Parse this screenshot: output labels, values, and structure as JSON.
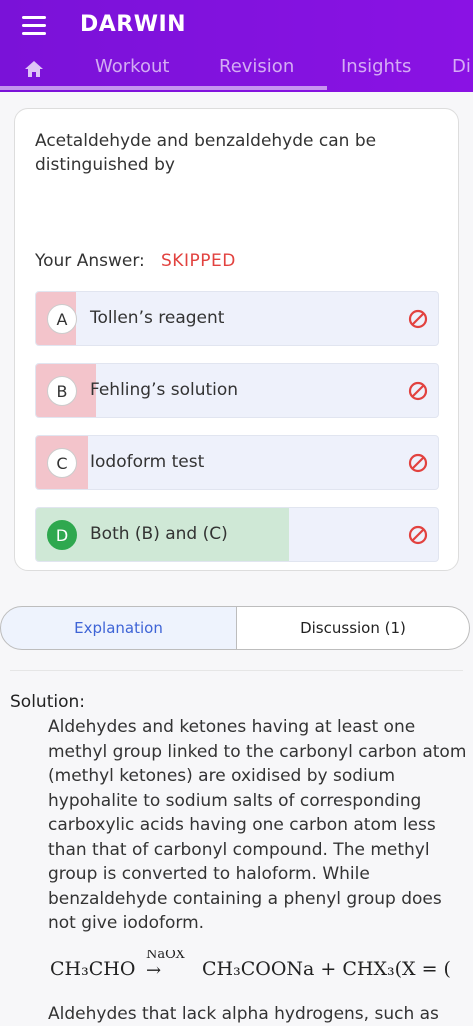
{
  "app": {
    "title": "DARWIN"
  },
  "tabs": [
    "Workout",
    "Revision",
    "Insights",
    "Di"
  ],
  "question": {
    "text": "Acetaldehyde and benzaldehyde can be distinguished by",
    "answer_label": "Your Answer:",
    "answer_status": "SKIPPED",
    "options": [
      {
        "letter": "A",
        "text": "Tollen’s reagent",
        "fill_fraction": 0.1,
        "fill_color": "#f3c4cb",
        "correct": false
      },
      {
        "letter": "B",
        "text": "Fehling’s solution",
        "fill_fraction": 0.15,
        "fill_color": "#f3c4cb",
        "correct": false
      },
      {
        "letter": "C",
        "text": "Iodoform test",
        "fill_fraction": 0.13,
        "fill_color": "#f3c4cb",
        "correct": false
      },
      {
        "letter": "D",
        "text": "Both (B) and (C)",
        "fill_fraction": 0.63,
        "fill_color": "#cfe8d6",
        "correct": true
      }
    ]
  },
  "segment": {
    "explanation": "Explanation",
    "discussion": "Discussion (1)"
  },
  "solution": {
    "label": "Solution:",
    "paragraph": "Aldehydes and ketones having at least one methyl group linked to the carbonyl carbon atom (methyl ketones) are oxidised by sodium hypohalite to sodium salts of corresponding carboxylic acids having one carbon atom less than that of carbonyl compound. The methyl group is converted to haloform. While benzaldehyde containing a phenyl group does not give iodoform.",
    "eq_lhs": "CH₃CHO",
    "eq_reagent": "NaOX",
    "eq_arrow": "→",
    "eq_rhs": "CH₃COONa + CHX₃(X = (",
    "paragraph2": "Aldehydes that lack alpha hydrogens, such as"
  },
  "colors": {
    "brand": "#7a12d8",
    "wrong": "#e2423f",
    "correct": "#2fa84f",
    "accent_blue": "#3e64d6"
  }
}
